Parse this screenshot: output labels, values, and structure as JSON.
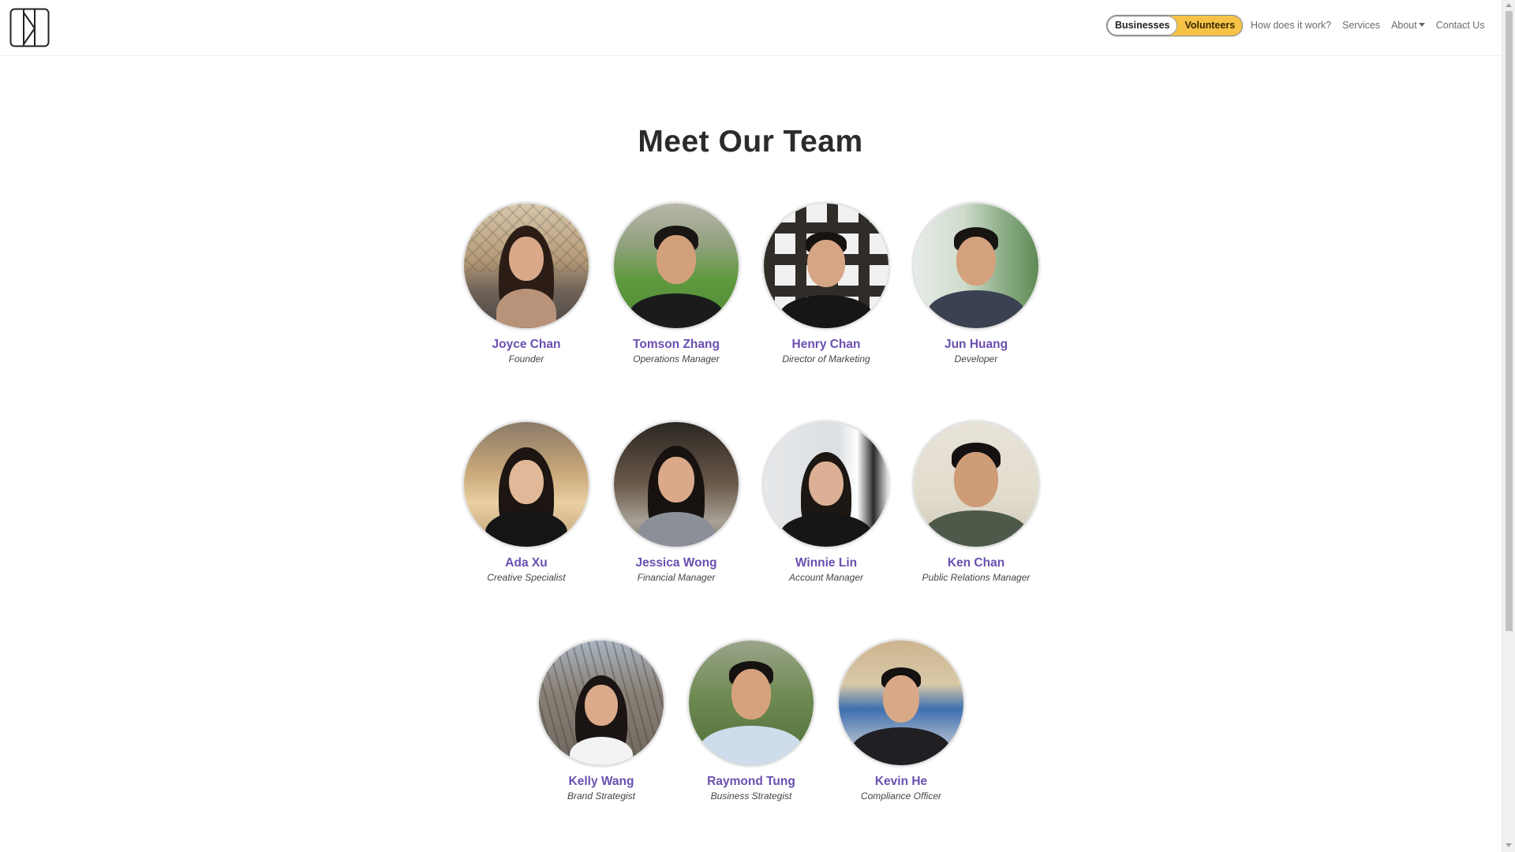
{
  "nav": {
    "toggle": {
      "businesses": "Businesses",
      "volunteers": "Volunteers"
    },
    "links": {
      "how": "How does it work?",
      "services": "Services",
      "about": "About",
      "contact": "Contact Us"
    }
  },
  "page": {
    "title": "Meet Our Team"
  },
  "team": [
    {
      "name": "Joyce Chan",
      "role": "Founder"
    },
    {
      "name": "Tomson Zhang",
      "role": "Operations Manager"
    },
    {
      "name": "Henry Chan",
      "role": "Director of Marketing"
    },
    {
      "name": "Jun Huang",
      "role": "Developer"
    },
    {
      "name": "Ada Xu",
      "role": "Creative Specialist"
    },
    {
      "name": "Jessica Wong",
      "role": "Financial Manager"
    },
    {
      "name": "Winnie Lin",
      "role": "Account Manager"
    },
    {
      "name": "Ken Chan",
      "role": "Public Relations Manager"
    },
    {
      "name": "Kelly Wang",
      "role": "Brand Strategist"
    },
    {
      "name": "Raymond Tung",
      "role": "Business Strategist"
    },
    {
      "name": "Kevin He",
      "role": "Compliance Officer"
    }
  ],
  "colors": {
    "accent_name": "#6a4fb0",
    "toggle_active": "#ffffff",
    "toggle_bg": "#f6c347"
  }
}
